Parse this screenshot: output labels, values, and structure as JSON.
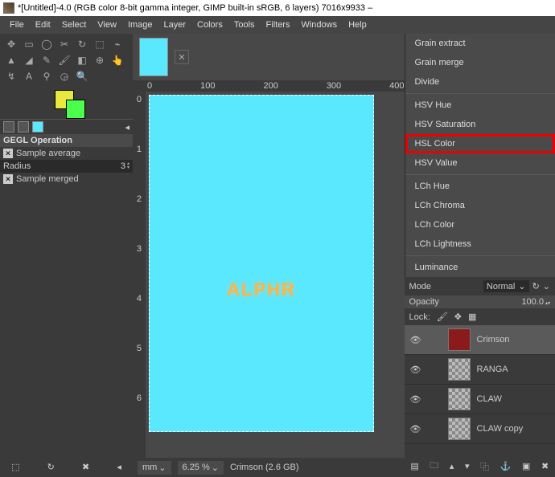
{
  "titlebar": {
    "text": "*[Untitled]-4.0 (RGB color 8-bit gamma integer, GIMP built-in sRGB, 6 layers) 7016x9933 –"
  },
  "menubar": [
    "File",
    "Edit",
    "Select",
    "View",
    "Image",
    "Layer",
    "Colors",
    "Tools",
    "Filters",
    "Windows",
    "Help"
  ],
  "toolopts": {
    "title": "GEGL Operation",
    "sample_average": "Sample average",
    "radius_label": "Radius",
    "radius_value": "3",
    "sample_merged": "Sample merged"
  },
  "ruler_h": [
    "0",
    "100",
    "200",
    "300",
    "400"
  ],
  "ruler_v": [
    "0",
    "1",
    "2",
    "3",
    "4",
    "5",
    "6"
  ],
  "canvas_text": "ALPHR",
  "status": {
    "unit": "mm",
    "zoom": "6.25 %",
    "info": "Crimson (2.6 GB)"
  },
  "blend_modes": {
    "group1": [
      "Grain extract",
      "Grain merge",
      "Divide"
    ],
    "group2": [
      "HSV Hue",
      "HSV Saturation",
      "HSL Color",
      "HSV Value"
    ],
    "group3": [
      "LCh Hue",
      "LCh Chroma",
      "LCh Color",
      "LCh Lightness"
    ],
    "group4": [
      "Luminance"
    ],
    "highlight": "HSL Color"
  },
  "mode": {
    "label": "Mode",
    "value": "Normal"
  },
  "opacity": {
    "label": "Opacity",
    "value": "100.0"
  },
  "lock": {
    "label": "Lock:"
  },
  "layers": [
    {
      "name": "Crimson",
      "visible": true,
      "sel": true,
      "red": true
    },
    {
      "name": "RANGA",
      "visible": true
    },
    {
      "name": "CLAW",
      "visible": true
    },
    {
      "name": "CLAW copy",
      "visible": true
    }
  ]
}
